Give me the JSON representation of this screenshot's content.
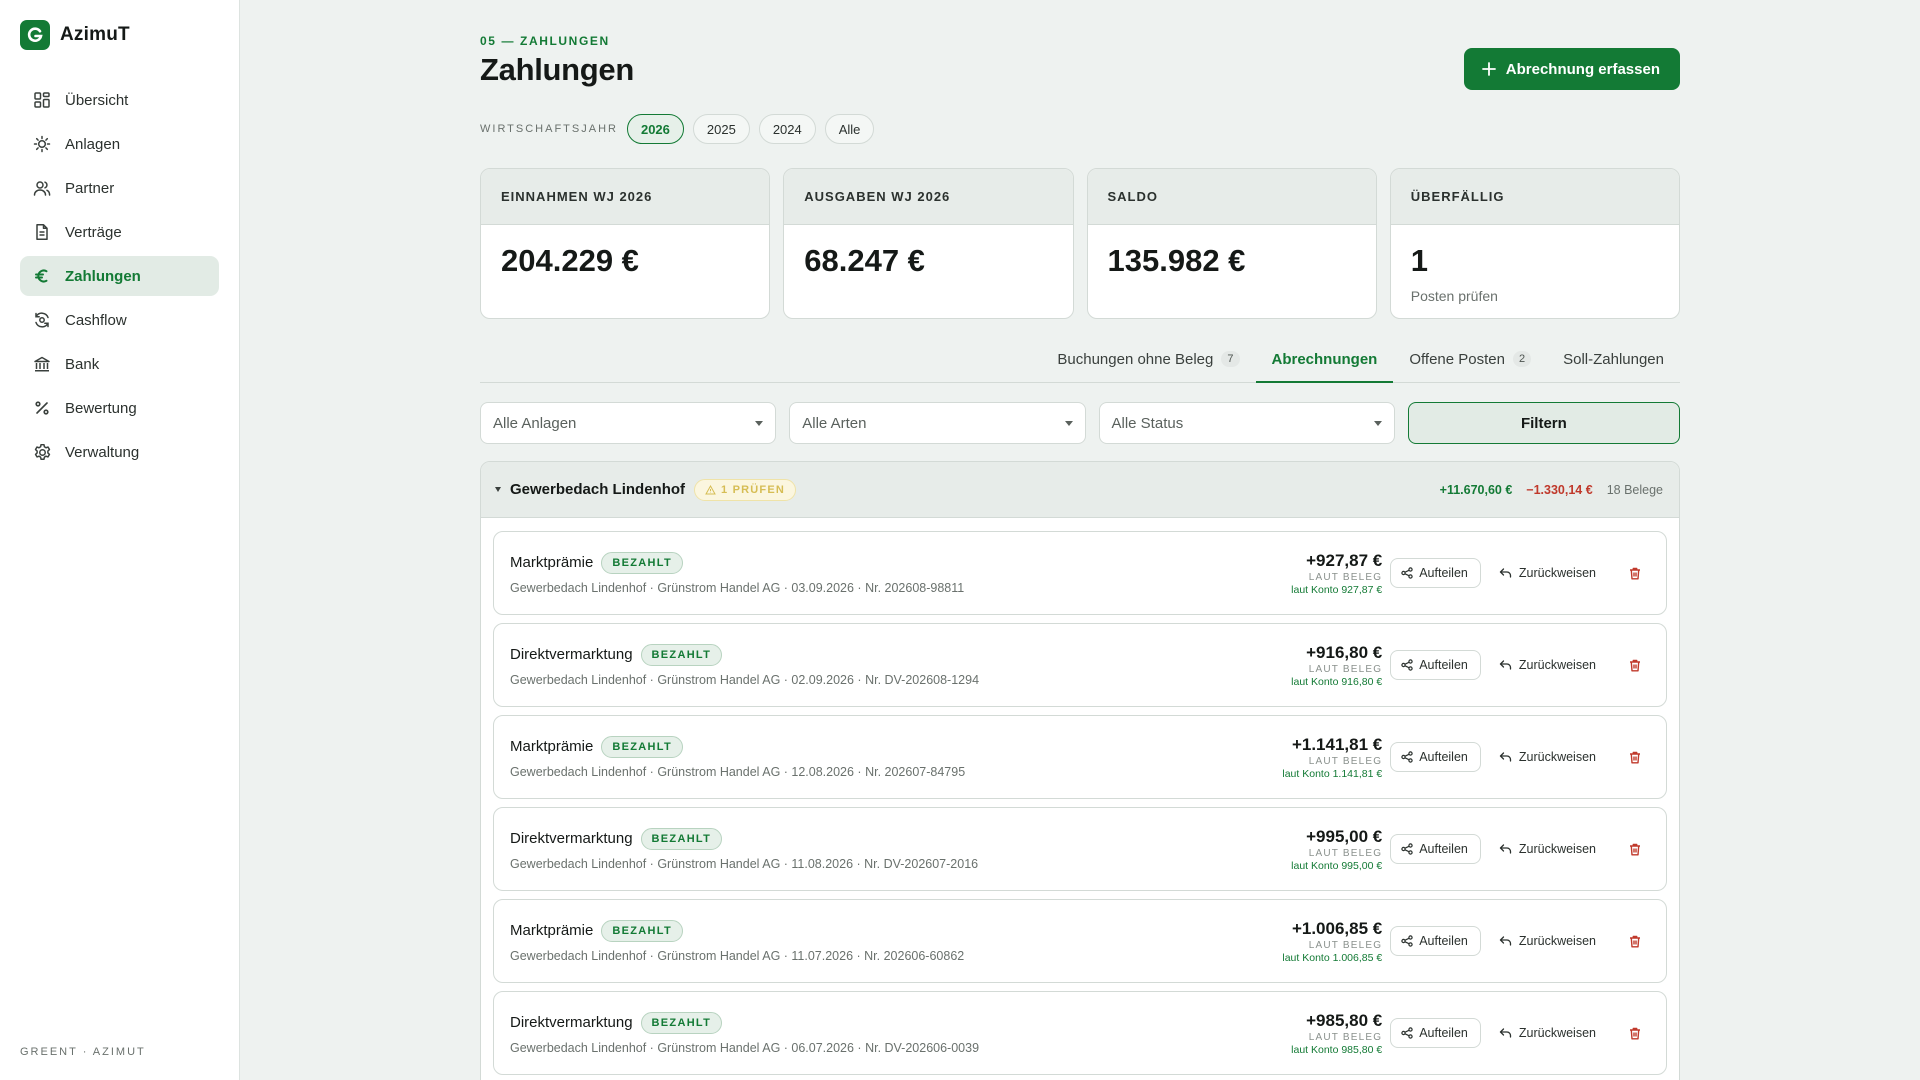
{
  "brand": {
    "name": "AzimuT"
  },
  "nav": {
    "items": [
      {
        "label": "Übersicht",
        "icon": "grid-icon"
      },
      {
        "label": "Anlagen",
        "icon": "sun-icon"
      },
      {
        "label": "Partner",
        "icon": "users-icon"
      },
      {
        "label": "Verträge",
        "icon": "document-icon"
      },
      {
        "label": "Zahlungen",
        "icon": "euro-icon",
        "active": true
      },
      {
        "label": "Cashflow",
        "icon": "cashflow-icon"
      },
      {
        "label": "Bank",
        "icon": "bank-icon"
      },
      {
        "label": "Bewertung",
        "icon": "percent-icon"
      },
      {
        "label": "Verwaltung",
        "icon": "gear-icon"
      }
    ],
    "footer": "GREENT · AZIMUT"
  },
  "page": {
    "kicker": "05 — ZAHLUNGEN",
    "title": "Zahlungen",
    "primary_action": "Abrechnung erfassen"
  },
  "fiscal_year": {
    "label": "WIRTSCHAFTSJAHR",
    "options": [
      "2026",
      "2025",
      "2024",
      "Alle"
    ],
    "selected": "2026"
  },
  "kpis": [
    {
      "label": "EINNAHMEN WJ 2026",
      "value": "204.229 €",
      "sub": ""
    },
    {
      "label": "AUSGABEN WJ 2026",
      "value": "68.247 €",
      "sub": ""
    },
    {
      "label": "SALDO",
      "value": "135.982 €",
      "sub": ""
    },
    {
      "label": "ÜBERFÄLLIG",
      "value": "1",
      "sub": "Posten prüfen"
    }
  ],
  "tabs": [
    {
      "label": "Buchungen ohne Beleg",
      "count": "7"
    },
    {
      "label": "Abrechnungen",
      "count": "",
      "active": true
    },
    {
      "label": "Offene Posten",
      "count": "2"
    },
    {
      "label": "Soll-Zahlungen",
      "count": ""
    }
  ],
  "filters": {
    "anlagen": "Alle Anlagen",
    "arten": "Alle Arten",
    "status": "Alle Status",
    "button": "Filtern"
  },
  "group": {
    "title": "Gewerbedach Lindenhof",
    "warning": "1 PRÜFEN",
    "income": "+11.670,60 €",
    "expense": "−1.330,14 €",
    "count": "18 Belege",
    "actions": {
      "split": "Aufteilen",
      "reject": "Zurückweisen"
    },
    "rows": [
      {
        "title": "Marktprämie",
        "status": "BEZAHLT",
        "sub": "Gewerbedach Lindenhof · Grünstrom Handel AG · 03.09.2026 · Nr. 202608-98811",
        "amount": "+927,87 €",
        "amount_label": "LAUT BELEG",
        "konto": "laut Konto 927,87 €"
      },
      {
        "title": "Direktvermarktung",
        "status": "BEZAHLT",
        "sub": "Gewerbedach Lindenhof · Grünstrom Handel AG · 02.09.2026 · Nr. DV-202608-1294",
        "amount": "+916,80 €",
        "amount_label": "LAUT BELEG",
        "konto": "laut Konto 916,80 €"
      },
      {
        "title": "Marktprämie",
        "status": "BEZAHLT",
        "sub": "Gewerbedach Lindenhof · Grünstrom Handel AG · 12.08.2026 · Nr. 202607-84795",
        "amount": "+1.141,81 €",
        "amount_label": "LAUT BELEG",
        "konto": "laut Konto 1.141,81 €"
      },
      {
        "title": "Direktvermarktung",
        "status": "BEZAHLT",
        "sub": "Gewerbedach Lindenhof · Grünstrom Handel AG · 11.08.2026 · Nr. DV-202607-2016",
        "amount": "+995,00 €",
        "amount_label": "LAUT BELEG",
        "konto": "laut Konto 995,00 €"
      },
      {
        "title": "Marktprämie",
        "status": "BEZAHLT",
        "sub": "Gewerbedach Lindenhof · Grünstrom Handel AG · 11.07.2026 · Nr. 202606-60862",
        "amount": "+1.006,85 €",
        "amount_label": "LAUT BELEG",
        "konto": "laut Konto 1.006,85 €"
      },
      {
        "title": "Direktvermarktung",
        "status": "BEZAHLT",
        "sub": "Gewerbedach Lindenhof · Grünstrom Handel AG · 06.07.2026 · Nr. DV-202606-0039",
        "amount": "+985,80 €",
        "amount_label": "LAUT BELEG",
        "konto": "laut Konto 985,80 €"
      }
    ]
  },
  "colors": {
    "accent": "#137a35",
    "danger": "#c0392b",
    "warning": "#d6bd54",
    "background": "#eef2f0"
  }
}
